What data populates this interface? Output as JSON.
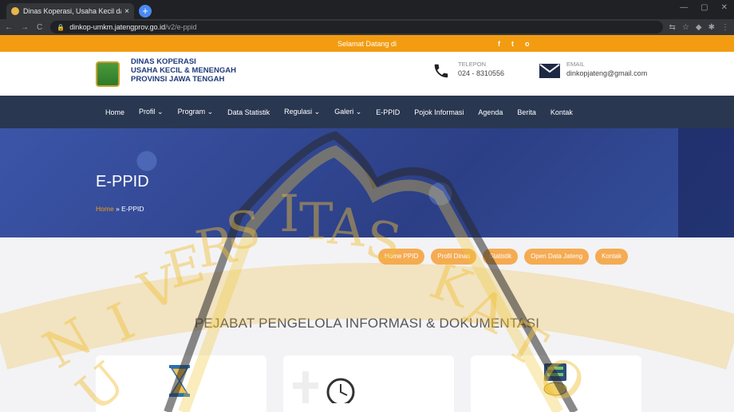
{
  "browser": {
    "tab_title": "Dinas Koperasi, Usaha Kecil dan",
    "tab_close": "×",
    "new_tab": "+",
    "url_host": "dinkop-umkm.jatengprov.go.id",
    "url_path": "/v2/e-ppid"
  },
  "site": {
    "welcome": "Selamat Datang di",
    "social": [
      "f",
      "t",
      "o"
    ],
    "logo": {
      "line1": "DINAS KOPERASI",
      "line2": "USAHA KECIL & MENENGAH",
      "line3": "PROVINSI JAWA TENGAH"
    },
    "phone": {
      "label": "TELEPON",
      "value": "024 - 8310556"
    },
    "email": {
      "label": "EMAIL",
      "value": "dinkopjateng@gmail.com"
    },
    "nav": [
      "Home",
      "Profil ⌄",
      "Program ⌄",
      "Data Statistik",
      "Regulasi ⌄",
      "Galeri ⌄",
      "E-PPID",
      "Pojok Informasi",
      "Agenda",
      "Berita",
      "Kontak"
    ],
    "hero": {
      "title": "E-PPID",
      "crumb_home": "Home",
      "crumb_sep": "»",
      "crumb_current": "E-PPID"
    },
    "pills": [
      "Home PPID",
      "Profil Dinas",
      "Statistik",
      "Open Data Jateng",
      "Kontak"
    ],
    "section_title": "PEJABAT PENGELOLA INFORMASI & DOKUMENTASI"
  },
  "colors": {
    "orange": "#f39c12",
    "navy": "#2a3751",
    "brand_text": "#1f3b7a"
  },
  "icons": [
    "hourglass-icon",
    "cross-clock-icon",
    "server-money-icon"
  ]
}
